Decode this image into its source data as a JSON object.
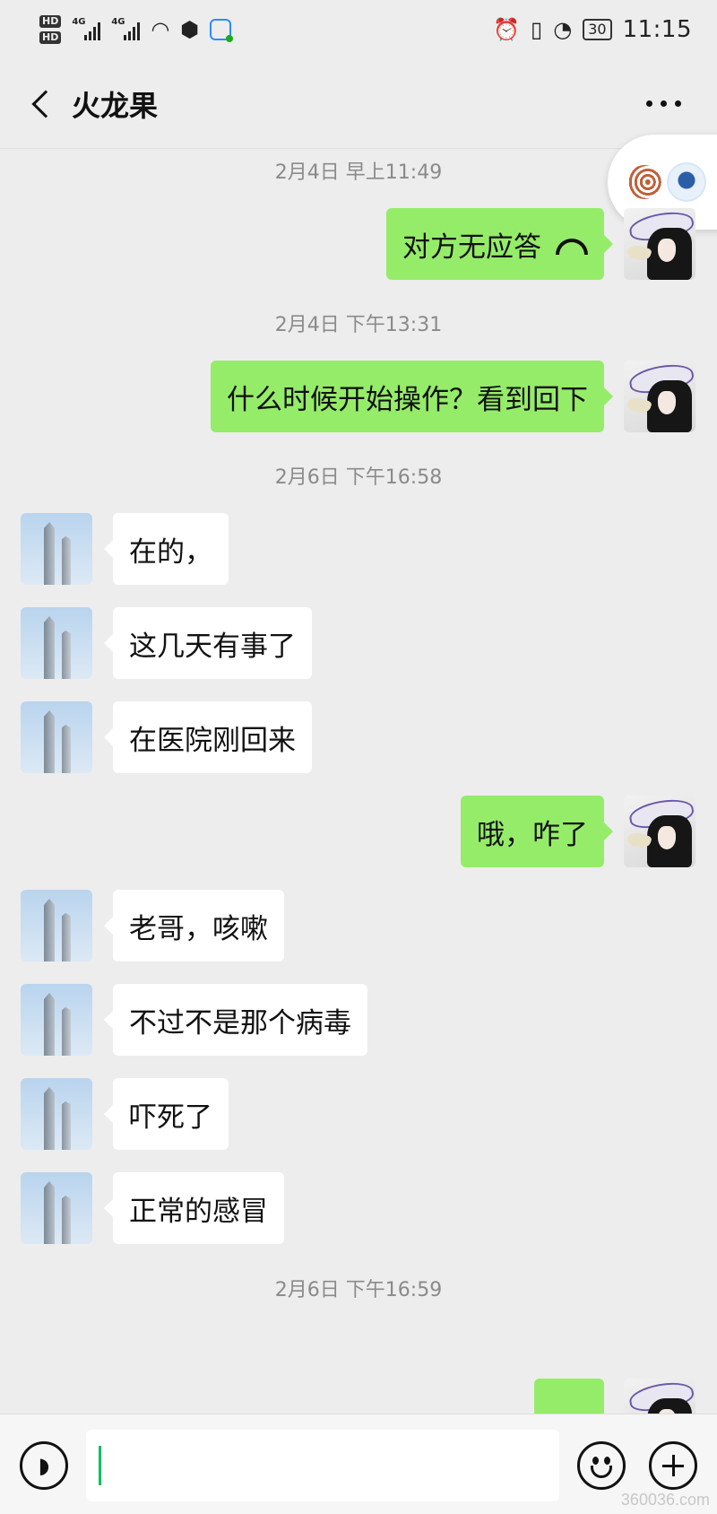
{
  "status_bar": {
    "hd1": "HD",
    "hd2": "HD",
    "net1": "4G",
    "net2": "4G",
    "battery": "30",
    "time": "11:15"
  },
  "header": {
    "title": "火龙果"
  },
  "messages": [
    {
      "timestamp": "2月4日 早上11:49"
    },
    {
      "side": "right",
      "text": "对方无应答",
      "icon": "phone-hangup-icon"
    },
    {
      "timestamp": "2月4日 下午13:31"
    },
    {
      "side": "right",
      "text": "什么时候开始操作？看到回下"
    },
    {
      "timestamp": "2月6日 下午16:58"
    },
    {
      "side": "left",
      "text": "在的，"
    },
    {
      "side": "left",
      "text": "这几天有事了"
    },
    {
      "side": "left",
      "text": "在医院刚回来"
    },
    {
      "side": "right",
      "text": "哦，咋了"
    },
    {
      "side": "left",
      "text": "老哥，咳嗽"
    },
    {
      "side": "left",
      "text": "不过不是那个病毒"
    },
    {
      "side": "left",
      "text": "吓死了"
    },
    {
      "side": "left",
      "text": "正常的感冒"
    },
    {
      "timestamp": "2月6日 下午16:59"
    },
    {
      "side": "right",
      "icon": "emoji-sticker-icon"
    }
  ],
  "input_bar": {
    "value": ""
  },
  "colors": {
    "background": "#ededed",
    "self_bubble": "#95ec69",
    "other_bubble": "#ffffff",
    "caret": "#07c160"
  },
  "watermark": "360036.com"
}
